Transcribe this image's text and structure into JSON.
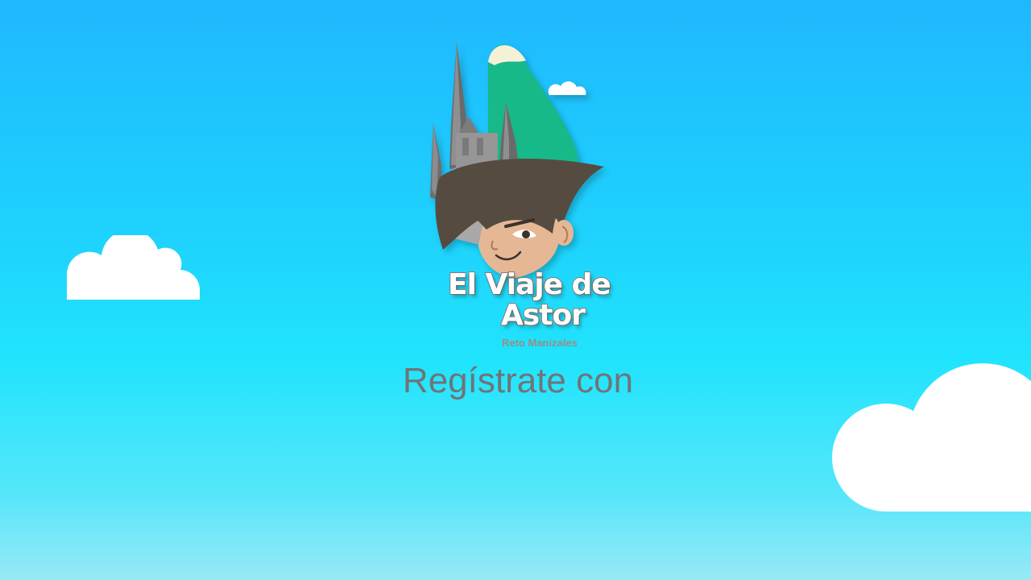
{
  "app": {
    "title": "El Viaje de Astor"
  },
  "logo": {
    "title_line1": "El Viaje de",
    "title_line2": "Astor",
    "subtitle": "Reto Manizales"
  },
  "register": {
    "heading": "Regístrate con"
  },
  "colors": {
    "sky_top": "#1fb8fe",
    "sky_bottom": "#98e9f5",
    "cloud": "#ffffff",
    "heading_text": "#6f7577",
    "mountain": "#12b987",
    "hair": "#554b40",
    "skin": "#e5b795"
  },
  "icons": {
    "cloud_left": "cloud-icon",
    "cloud_right": "cloud-icon",
    "logo_cloud": "cloud-icon"
  }
}
